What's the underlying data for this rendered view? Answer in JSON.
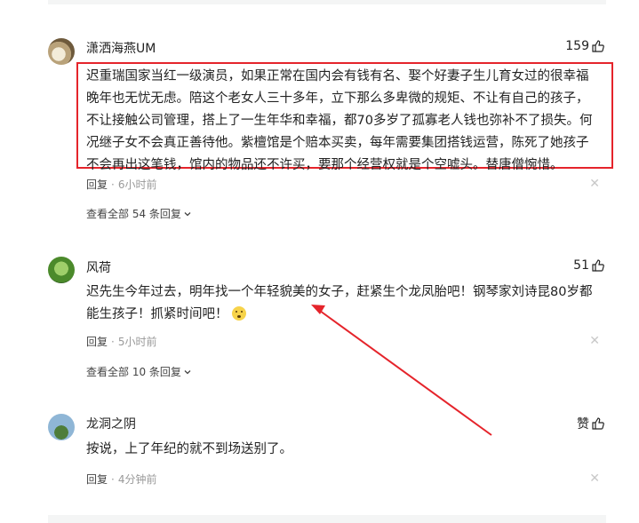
{
  "comments": [
    {
      "username": "潇洒海燕UM",
      "likes": "159",
      "lines": [
        "迟重瑞国家当红一级演员，如果正常在国内会有钱有名、娶个好妻子生儿育女过的很幸福",
        "晚年也无忧无虑。陪这个老女人三十多年，立下那么多卑微的规矩、不让有自己的孩子，",
        "不让接触公司管理，搭上了一生年华和幸福，都70多岁了孤寡老人钱也弥补不了损失。何",
        "况继子女不会真正善待他。紫檀馆是个赔本买卖，每年需要集团搭钱运营，陈死了她孩子",
        "不会再出这笔钱，馆内的物品还不许买，要那个经营权就是个空嘘头。替唐僧惋惜。"
      ],
      "reply_label": "回复",
      "separator": "·",
      "time": "6小时前",
      "view_all": "查看全部 54 条回复"
    },
    {
      "username": "风荷",
      "likes": "51",
      "lines": [
        "迟先生今年过去，明年找一个年轻貌美的女子，赶紧生个龙凤胎吧！钢琴家刘诗昆80岁都",
        "能生孩子！抓紧时间吧！"
      ],
      "emoji": "surprised-face",
      "reply_label": "回复",
      "separator": "·",
      "time": "5小时前",
      "view_all": "查看全部 10 条回复"
    },
    {
      "username": "龙洞之阴",
      "likes": "赞",
      "lines": [
        "按说，上了年纪的就不到场送别了。"
      ],
      "reply_label": "回复",
      "separator": "·",
      "time": "4分钟前"
    }
  ],
  "colors": {
    "highlight_box": "#e5242b",
    "annotation_arrow": "#e5242b",
    "meta_text": "#999999"
  },
  "icons": {
    "like": "thumbs-up-icon",
    "close": "close-icon",
    "expand": "chevron-down-icon"
  }
}
